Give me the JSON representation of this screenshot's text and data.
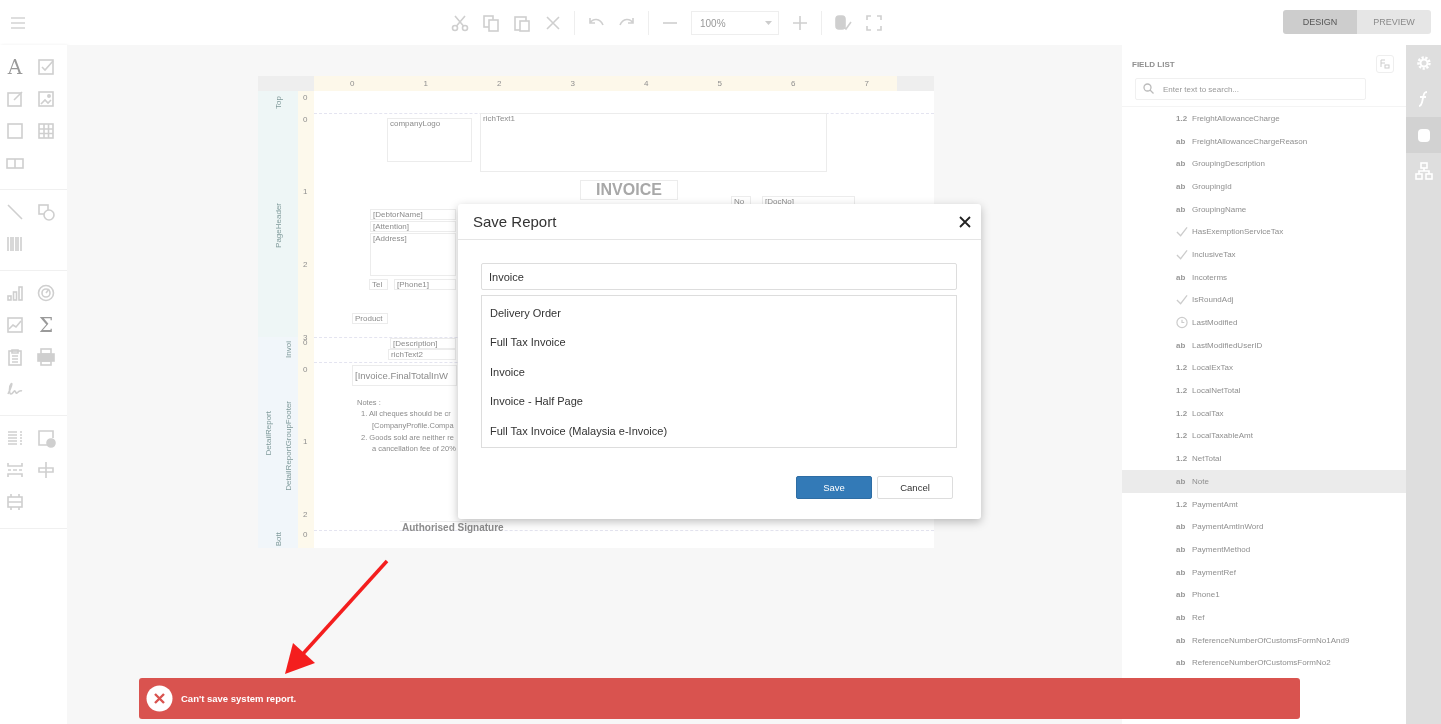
{
  "toolbar": {
    "zoom": "100%",
    "tabs": [
      {
        "label": "DESIGN",
        "selected": true
      },
      {
        "label": "PREVIEW",
        "selected": false
      }
    ]
  },
  "toolbox": [
    [
      {
        "kind": "label",
        "glyph": "A"
      },
      {
        "kind": "checkbox"
      },
      {
        "kind": "richtext"
      },
      {
        "kind": "picture"
      },
      {
        "kind": "panel"
      },
      {
        "kind": "table"
      },
      {
        "kind": "comb"
      }
    ],
    [
      {
        "kind": "line"
      },
      {
        "kind": "shape"
      },
      {
        "kind": "barcode"
      }
    ],
    [
      {
        "kind": "chart"
      },
      {
        "kind": "gauge"
      },
      {
        "kind": "sparkline"
      },
      {
        "kind": "summary",
        "glyph": "Σ"
      },
      {
        "kind": "subreport"
      },
      {
        "kind": "pdf"
      },
      {
        "kind": "signature"
      }
    ],
    [
      {
        "kind": "toc"
      },
      {
        "kind": "pageinfo"
      },
      {
        "kind": "pagebreak"
      },
      {
        "kind": "crossband"
      },
      {
        "kind": "bandbreak"
      }
    ]
  ],
  "report": {
    "ruler": [
      "0",
      "1",
      "2",
      "3",
      "4",
      "5",
      "6",
      "7"
    ],
    "vertical_ruler": [
      "0",
      "0",
      "1",
      "2",
      "3",
      "0",
      "0",
      "1",
      "2",
      "0"
    ],
    "bands": [
      "Top",
      "PageHeader",
      "Invoi",
      "DetailReportGroupFooter",
      "DetailReport",
      "Bott"
    ],
    "controls": [
      {
        "kind": "box",
        "text": "companyLogo"
      },
      {
        "kind": "box",
        "text": "richText1"
      },
      {
        "kind": "title",
        "text": "INVOICE"
      },
      {
        "kind": "field",
        "text": "No"
      },
      {
        "kind": "field",
        "text": "[DocNo]"
      },
      {
        "kind": "field",
        "text": "[DebtorName]"
      },
      {
        "kind": "field",
        "text": "[Attention]"
      },
      {
        "kind": "field",
        "text": "[Address]"
      },
      {
        "kind": "field",
        "text": "Tel"
      },
      {
        "kind": "field",
        "text": "[Phone1]"
      },
      {
        "kind": "field",
        "text": "Product"
      },
      {
        "kind": "field",
        "text": "[Description]"
      },
      {
        "kind": "field",
        "text": "richText2"
      },
      {
        "kind": "big",
        "text": "[Invoice.FinalTotalInW"
      },
      {
        "kind": "note",
        "text": "Notes :"
      },
      {
        "kind": "note",
        "text": "1. All cheques should be cr"
      },
      {
        "kind": "note",
        "text": "[CompanyProfile.Compa"
      },
      {
        "kind": "note",
        "text": "2. Goods sold are neither re"
      },
      {
        "kind": "note",
        "text": "a cancellation fee of 20%"
      },
      {
        "kind": "sign",
        "text": "Authorised Signature"
      }
    ]
  },
  "field_list": {
    "title": "FIELD LIST",
    "search_placeholder": "Enter text to search...",
    "items": [
      {
        "kind": "number",
        "tag": "1.2",
        "name": "FreightAllowanceCharge",
        "selected": false
      },
      {
        "kind": "string",
        "tag": "ab",
        "name": "FreightAllowanceChargeReason",
        "selected": false
      },
      {
        "kind": "string",
        "tag": "ab",
        "name": "GroupingDescription",
        "selected": false
      },
      {
        "kind": "string",
        "tag": "ab",
        "name": "GroupingId",
        "selected": false
      },
      {
        "kind": "string",
        "tag": "ab",
        "name": "GroupingName",
        "selected": false
      },
      {
        "kind": "bool",
        "name": "HasExemptionServiceTax",
        "selected": false
      },
      {
        "kind": "bool",
        "name": "InclusiveTax",
        "selected": false
      },
      {
        "kind": "string",
        "tag": "ab",
        "name": "Incoterms",
        "selected": false
      },
      {
        "kind": "bool",
        "name": "IsRoundAdj",
        "selected": false
      },
      {
        "kind": "date",
        "name": "LastModified",
        "selected": false
      },
      {
        "kind": "string",
        "tag": "ab",
        "name": "LastModifiedUserID",
        "selected": false
      },
      {
        "kind": "number",
        "tag": "1.2",
        "name": "LocalExTax",
        "selected": false
      },
      {
        "kind": "number",
        "tag": "1.2",
        "name": "LocalNetTotal",
        "selected": false
      },
      {
        "kind": "number",
        "tag": "1.2",
        "name": "LocalTax",
        "selected": false
      },
      {
        "kind": "number",
        "tag": "1.2",
        "name": "LocalTaxableAmt",
        "selected": false
      },
      {
        "kind": "number",
        "tag": "1.2",
        "name": "NetTotal",
        "selected": false
      },
      {
        "kind": "string",
        "tag": "ab",
        "name": "Note",
        "selected": true
      },
      {
        "kind": "number",
        "tag": "1.2",
        "name": "PaymentAmt",
        "selected": false
      },
      {
        "kind": "string",
        "tag": "ab",
        "name": "PaymentAmtInWord",
        "selected": false
      },
      {
        "kind": "string",
        "tag": "ab",
        "name": "PaymentMethod",
        "selected": false
      },
      {
        "kind": "string",
        "tag": "ab",
        "name": "PaymentRef",
        "selected": false
      },
      {
        "kind": "string",
        "tag": "ab",
        "name": "Phone1",
        "selected": false
      },
      {
        "kind": "string",
        "tag": "ab",
        "name": "Ref",
        "selected": false
      },
      {
        "kind": "string",
        "tag": "ab",
        "name": "ReferenceNumberOfCustomsFormNo1And9",
        "selected": false
      },
      {
        "kind": "string",
        "tag": "ab",
        "name": "ReferenceNumberOfCustomsFormNo2",
        "selected": false
      }
    ]
  },
  "side_tabs": [
    {
      "kind": "properties",
      "selected": false
    },
    {
      "kind": "expressions",
      "selected": false
    },
    {
      "kind": "fields",
      "selected": true
    },
    {
      "kind": "outline",
      "selected": false
    }
  ],
  "dialog": {
    "title": "Save Report",
    "name_value": "Invoice",
    "reports": [
      {
        "name": "Delivery Order",
        "selected": false
      },
      {
        "name": "Full Tax Invoice",
        "selected": false
      },
      {
        "name": "Invoice",
        "selected": false
      },
      {
        "name": "Invoice - Half Page",
        "selected": false
      },
      {
        "name": "Full Tax Invoice (Malaysia e-Invoice)",
        "selected": false
      }
    ],
    "buttons": [
      {
        "kind": "primary",
        "label": "Save"
      },
      {
        "kind": "secondary",
        "label": "Cancel"
      }
    ]
  },
  "toast": {
    "kind": "error",
    "message": "Can't save system report."
  }
}
